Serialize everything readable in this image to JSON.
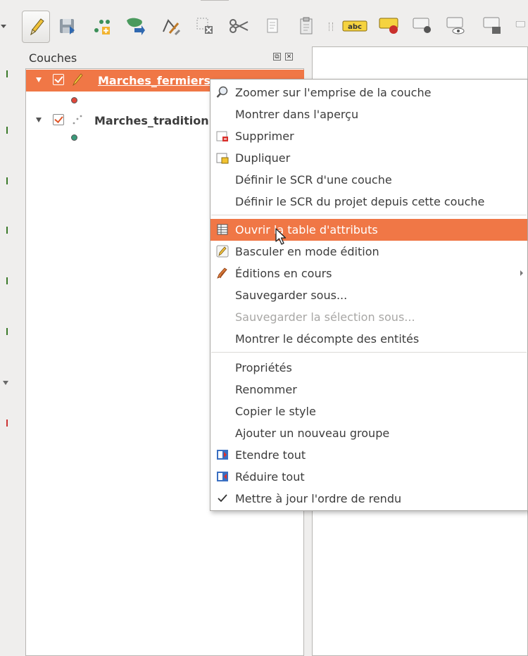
{
  "layers_panel": {
    "title": "Couches",
    "layers": [
      {
        "name": "Marches_fermiers",
        "checked": true,
        "selected": true,
        "editing": true,
        "symbol_color": "#e0473a"
      },
      {
        "name": "Marches_tradition",
        "checked": true,
        "selected": false,
        "editing": false,
        "symbol_color": "#3a9a7a"
      }
    ]
  },
  "context_menu": {
    "items": [
      {
        "label": "Zoomer sur l'emprise de la couche",
        "icon": "zoom-magnifier-icon"
      },
      {
        "label": "Montrer dans l'aperçu",
        "icon": ""
      },
      {
        "label": "Supprimer",
        "icon": "remove-layer-icon"
      },
      {
        "label": "Dupliquer",
        "icon": "duplicate-layer-icon"
      },
      {
        "label": "Définir le SCR d'une couche",
        "icon": ""
      },
      {
        "label": "Définir le SCR du projet depuis cette couche",
        "icon": ""
      },
      {
        "label": "Ouvrir la table d'attributs",
        "icon": "attribute-table-icon",
        "highlighted": true
      },
      {
        "label": "Basculer en mode édition",
        "icon": "pencil-icon"
      },
      {
        "label": "Éditions en cours",
        "icon": "current-edits-icon",
        "submenu": true
      },
      {
        "label": "Sauvegarder sous...",
        "icon": ""
      },
      {
        "label": "Sauvegarder la sélection sous...",
        "icon": "",
        "disabled": true
      },
      {
        "label": "Montrer le décompte des entités",
        "icon": ""
      },
      {
        "label": "Propriétés",
        "icon": ""
      },
      {
        "label": "Renommer",
        "icon": ""
      },
      {
        "label": "Copier le style",
        "icon": ""
      },
      {
        "label": "Ajouter un nouveau groupe",
        "icon": ""
      },
      {
        "label": "Etendre tout",
        "icon": "expand-all-icon"
      },
      {
        "label": "Réduire tout",
        "icon": "collapse-all-icon"
      },
      {
        "label": "Mettre à jour l'ordre de rendu",
        "icon": "checkmark-icon",
        "checked": true
      }
    ]
  },
  "toolbar": {
    "items": [
      "toggle-editing",
      "save-edits",
      "add-point-feature",
      "move-feature",
      "node-tool",
      "delete-selected",
      "cut-features",
      "copy-features",
      "paste-features",
      "label-abc",
      "label-pin",
      "label-move",
      "label-show-hide",
      "label-change",
      "label-rotate"
    ],
    "label_text": "abc"
  },
  "colors": {
    "accent": "#f07746",
    "menu_background": "#ffffff",
    "panel_background": "#efeeed",
    "text": "#3c3c3c",
    "disabled_text": "#a8a7a5"
  }
}
